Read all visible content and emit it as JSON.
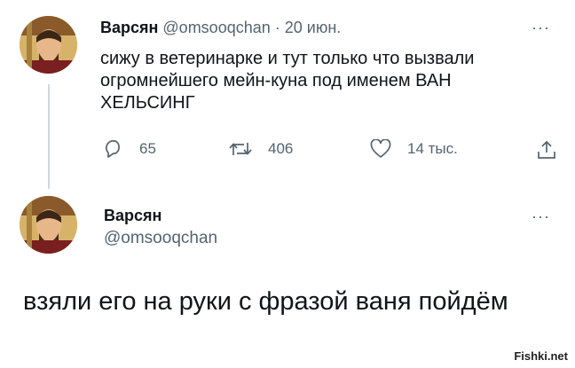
{
  "tweet1": {
    "author": "Варсян",
    "handle": "@omsooqchan",
    "separator": "·",
    "date": "20 июн.",
    "more": "···",
    "text": "сижу в ветеринарке и тут только что вызвали огромнейшего мейн-куна под именем ВАН ХЕЛЬСИНГ",
    "replies": "65",
    "retweets": "406",
    "likes": "14 тыс."
  },
  "tweet2": {
    "author": "Варсян",
    "handle": "@omsooqchan",
    "more": "···",
    "text": "взяли его на руки с фразой ваня пойдём"
  },
  "icons": {
    "reply": "reply-bubble-icon",
    "retweet": "retweet-arrows-icon",
    "like": "heart-icon",
    "share": "share-upload-icon"
  },
  "watermark": "Fishki.net",
  "colors": {
    "text": "#0f1419",
    "secondary": "#536471",
    "thread_line": "#cfd9de"
  }
}
